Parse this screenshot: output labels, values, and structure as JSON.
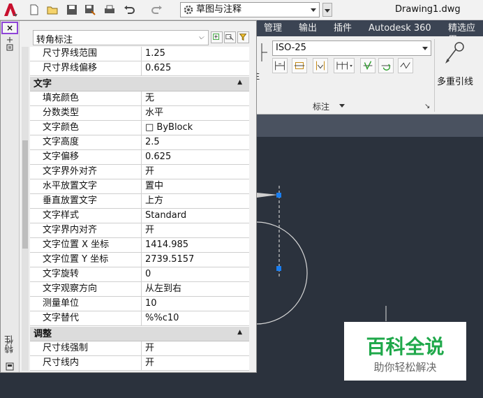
{
  "titlebar": {
    "workspace": "草图与注释",
    "document_title": "Drawing1.dwg"
  },
  "ribbon": {
    "tabs": [
      "管理",
      "输出",
      "插件",
      "Autodesk 360",
      "精选应用"
    ],
    "dim_style": "ISO-25",
    "panel_label": "标注",
    "multileader_label": "多重引线",
    "stub_text": "注"
  },
  "palette": {
    "title": "特性",
    "close_label": "×",
    "selector": "转角标注",
    "rows_top": [
      {
        "name": "尺寸界线范围",
        "value": "1.25"
      },
      {
        "name": "尺寸界线偏移",
        "value": "0.625"
      }
    ],
    "categories": {
      "text": "文字",
      "adjust": "调整"
    },
    "rows_text": [
      {
        "name": "填充颜色",
        "value": "无"
      },
      {
        "name": "分数类型",
        "value": "水平"
      },
      {
        "name": "文字颜色",
        "value": "□ ByBlock"
      },
      {
        "name": "文字高度",
        "value": "2.5"
      },
      {
        "name": "文字偏移",
        "value": "0.625"
      },
      {
        "name": "文字界外对齐",
        "value": "开"
      },
      {
        "name": "水平放置文字",
        "value": "置中"
      },
      {
        "name": "垂直放置文字",
        "value": "上方"
      },
      {
        "name": "文字样式",
        "value": "Standard"
      },
      {
        "name": "文字界内对齐",
        "value": "开"
      },
      {
        "name": "文字位置 X 坐标",
        "value": "1414.985"
      },
      {
        "name": "文字位置 Y 坐标",
        "value": "2739.5157"
      },
      {
        "name": "文字旋转",
        "value": "0"
      },
      {
        "name": "文字观察方向",
        "value": "从左到右"
      },
      {
        "name": "测量单位",
        "value": "10"
      },
      {
        "name": "文字替代",
        "value": "%%c10"
      }
    ],
    "rows_adjust": [
      {
        "name": "尺寸线强制",
        "value": "开"
      },
      {
        "name": "尺寸线内",
        "value": "开"
      }
    ]
  },
  "watermark": {
    "title": "百科全说",
    "subtitle": "助你轻松解决"
  },
  "colors": {
    "canvas": "#2b323d",
    "ribbon_tab_bar": "#3b4453",
    "grip": "#1a7ef0",
    "watermark_green": "#1fa84a",
    "close_highlight": "#8e44d8"
  }
}
